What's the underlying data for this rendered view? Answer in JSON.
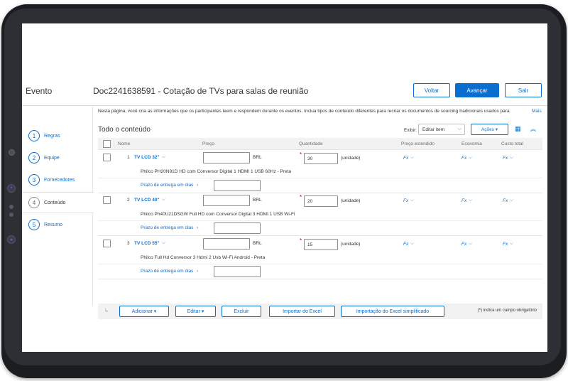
{
  "header": {
    "section": "Evento",
    "title": "Doc2241638591 - Cotação de TVs para salas de reunião",
    "buttons": {
      "back": "Voltar",
      "next": "Avançar",
      "exit": "Sair"
    }
  },
  "nav": {
    "items": [
      {
        "num": "1",
        "label": "Regras"
      },
      {
        "num": "2",
        "label": "Equipe"
      },
      {
        "num": "3",
        "label": "Fornecedores"
      },
      {
        "num": "4",
        "label": "Conteúdo"
      },
      {
        "num": "5",
        "label": "Resumo"
      }
    ]
  },
  "content": {
    "intro": "Nesta página, você cria as informações que os participantes leem e respondem durante os eventos. Inclua tipos de conteúdo diferentes para recriar os documentos de sourcing tradicionais usados para",
    "intro_more": "Mais",
    "title": "Todo o conteúdo",
    "view_label": "Exibir:",
    "view_value": "Editar item",
    "actions_label": "Ações ▾"
  },
  "table": {
    "headers": {
      "name": "Nome",
      "price": "Preço",
      "quantity": "Quantidade",
      "extended_price": "Preço estendido",
      "savings": "Economia",
      "total_cost": "Custo total"
    },
    "rows": [
      {
        "num": "1",
        "name": "TV LCD 32\"",
        "currency": "BRL",
        "quantity": "30",
        "unit": "(unidade)",
        "fx": "Fx",
        "description": "Philco PH20N91D HD com Conversor Digital 1 HDMI 1 USB 60Hz - Preta",
        "delivery_label": "Prazo de entrega em dias"
      },
      {
        "num": "2",
        "name": "TV LCD 40\"",
        "currency": "BRL",
        "quantity": "20",
        "unit": "(unidade)",
        "fx": "Fx",
        "description": "Philco Ph40U21DSGW Full HD com Conversor Digital 3 HDMI 1 USB Wi-Fi",
        "delivery_label": "Prazo de entrega em dias"
      },
      {
        "num": "3",
        "name": "TV LCD 55\"",
        "currency": "BRL",
        "quantity": "15",
        "unit": "(unidade)",
        "fx": "Fx",
        "description": "Philco Full Hd Conversor 3 Hdmi 2 Usb Wi-Fi Android - Preta",
        "delivery_label": "Prazo de entrega em dias"
      }
    ]
  },
  "footer": {
    "add": "Adicionar ▾",
    "edit": "Editar ▾",
    "delete": "Excluir",
    "import_excel": "Importar do Excel",
    "import_excel_simple": "Importação do Excel simplificado",
    "required_note": "(*) indica um campo obrigatório"
  },
  "colors": {
    "accent": "#0a6ed1",
    "required": "#bb0000",
    "frame": "#1b1d20"
  }
}
